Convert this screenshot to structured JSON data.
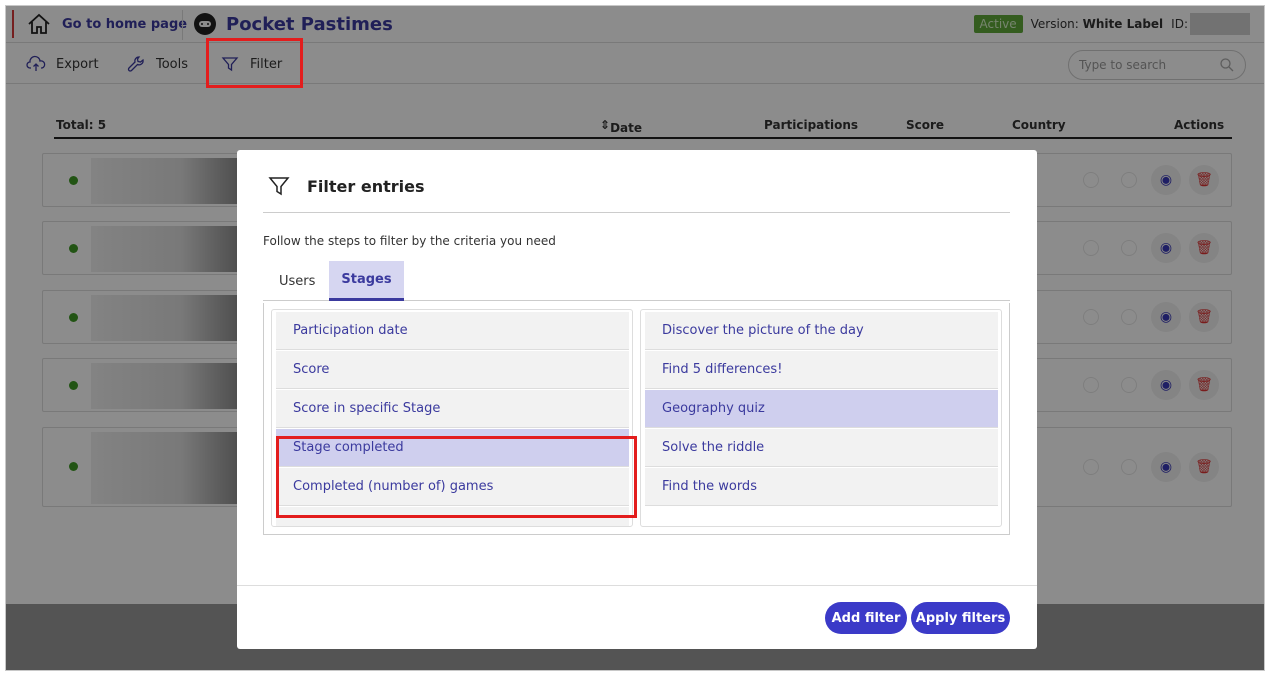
{
  "header": {
    "home_label": "Go to home page",
    "app_title": "Pocket Pastimes",
    "status_badge": "Active",
    "version_label": "Version:",
    "version_value": "White Label",
    "id_label": "ID:"
  },
  "toolbar": {
    "export_label": "Export",
    "tools_label": "Tools",
    "filter_label": "Filter",
    "search_placeholder": "Type to search"
  },
  "table": {
    "total": "Total: 5",
    "columns": {
      "date": "Date",
      "participations": "Participations",
      "score": "Score",
      "country": "Country",
      "actions": "Actions"
    },
    "row_count": 5
  },
  "modal": {
    "title": "Filter entries",
    "description": "Follow the steps to filter by the criteria you need",
    "tabs": [
      "Users",
      "Stages"
    ],
    "active_tab": "Stages",
    "left_options": [
      "Participation date",
      "Score",
      "Score in specific Stage",
      "Stage completed",
      "Completed (number of) games"
    ],
    "left_selected": "Stage completed",
    "right_options": [
      "Discover the picture of the day",
      "Find 5 differences!",
      "Geography quiz",
      "Solve the riddle",
      "Find the words"
    ],
    "right_selected": "Geography quiz",
    "add_filter_label": "Add filter",
    "apply_filters_label": "Apply filters"
  },
  "colors": {
    "accent": "#3b3a9e",
    "button": "#3b3ac8",
    "selected_bg": "#cfcfee",
    "highlight": "#e31d1d",
    "active_badge": "#5fa83a"
  }
}
